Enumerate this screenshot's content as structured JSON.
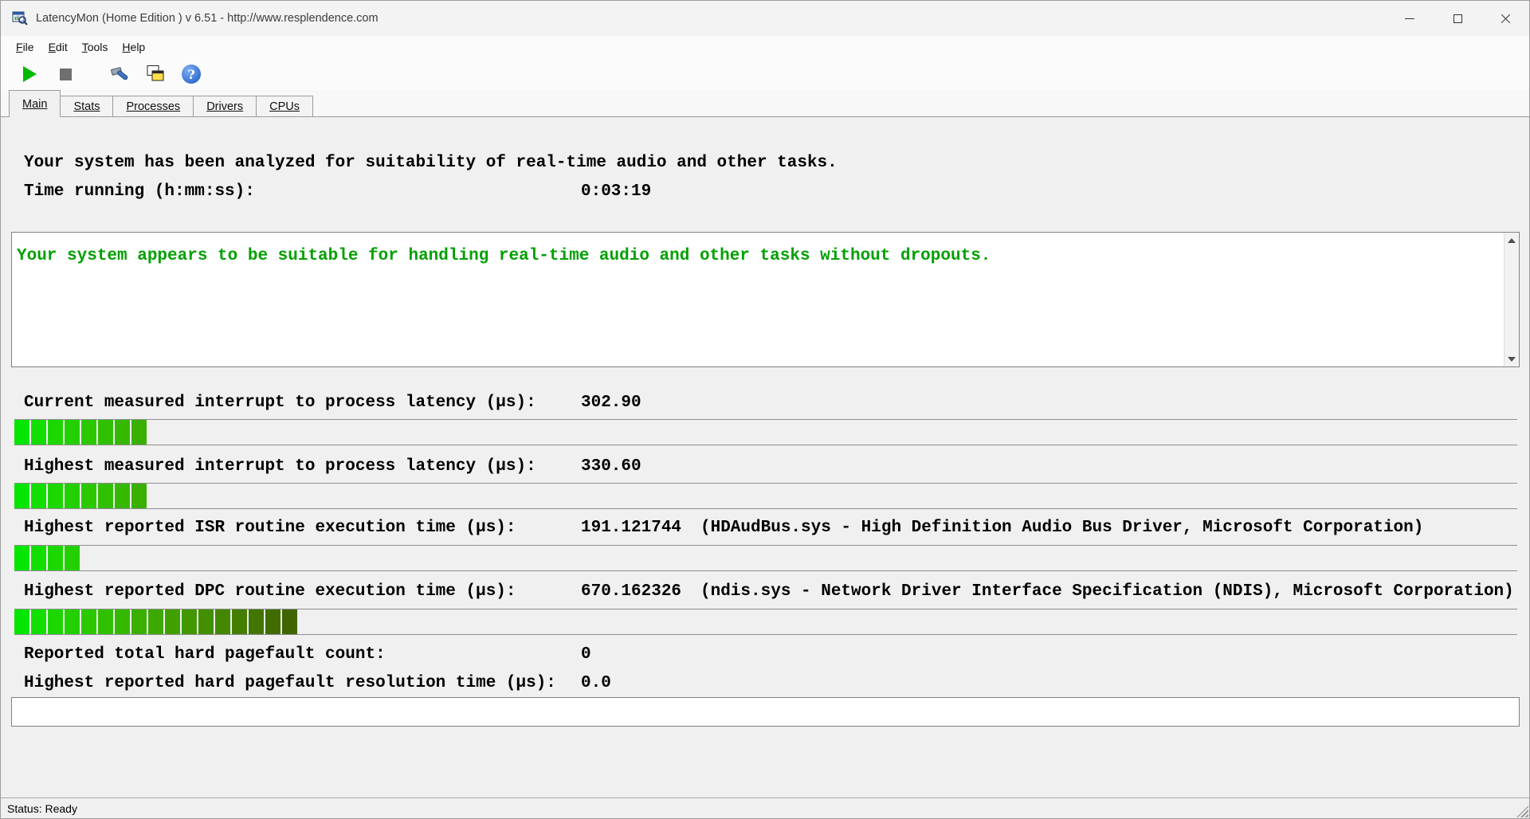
{
  "window": {
    "title": "LatencyMon  (Home Edition )  v 6.51 - http://www.resplendence.com"
  },
  "menu": {
    "items": [
      "File",
      "Edit",
      "Tools",
      "Help"
    ]
  },
  "toolbar": {
    "play_color": "#00ba00",
    "buttons": [
      {
        "name": "start",
        "icon": "play-icon"
      },
      {
        "name": "stop",
        "icon": "stop-icon"
      },
      {
        "name": "options",
        "icon": "options-icon"
      },
      {
        "name": "copy-report",
        "icon": "copy-report-icon"
      },
      {
        "name": "help",
        "icon": "help-icon"
      }
    ]
  },
  "tabs": {
    "items": [
      "Main",
      "Stats",
      "Processes",
      "Drivers",
      "CPUs"
    ],
    "selected": "Main"
  },
  "main": {
    "headline": "Your system has been analyzed for suitability of real-time audio and other tasks.",
    "time_running_label": "Time running (h:mm:ss):",
    "time_running_value": "0:03:19",
    "report_message": "Your system appears to be suitable for handling real-time audio and other tasks without dropouts.",
    "report_color": "#00a000",
    "metrics": [
      {
        "label": "Current measured interrupt to process latency (µs):",
        "value": "302.90",
        "detail": "",
        "segments": 8
      },
      {
        "label": "Highest measured interrupt to process latency (µs):",
        "value": "330.60",
        "detail": "",
        "segments": 8
      },
      {
        "label": "Highest reported ISR routine execution time (µs):",
        "value": "191.121744",
        "detail": "(HDAudBus.sys - High Definition Audio Bus Driver, Microsoft Corporation)",
        "segments": 4
      },
      {
        "label": "Highest reported DPC routine execution time (µs):",
        "value": "670.162326",
        "detail": "(ndis.sys - Network Driver Interface Specification (NDIS), Microsoft Corporation)",
        "segments": 17
      },
      {
        "label": "Reported total hard pagefault count:",
        "value": "0",
        "detail": "",
        "segments": 0
      },
      {
        "label": "Highest reported hard pagefault resolution time (µs):",
        "value": "0.0",
        "detail": "",
        "segments": 0
      }
    ],
    "bar_colors": [
      "#06e500",
      "#12de00",
      "#1cd700",
      "#24cf00",
      "#2bc800",
      "#30c000",
      "#35b800",
      "#39b000",
      "#3ca800",
      "#3fa000",
      "#419800",
      "#428f00",
      "#438700",
      "#437e00",
      "#427600",
      "#416d00",
      "#3f6500"
    ]
  },
  "statusbar": {
    "text": "Status: Ready"
  }
}
